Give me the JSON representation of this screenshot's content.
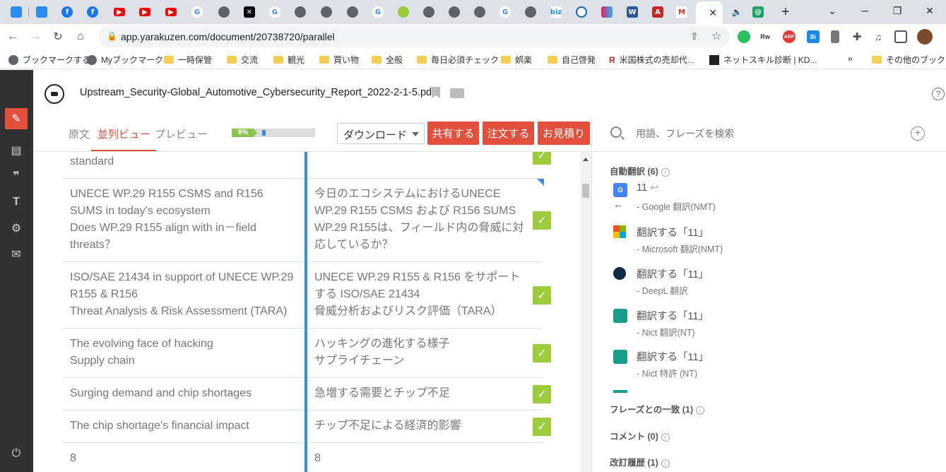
{
  "browser": {
    "url": "app.yarakuzen.com/document/20738720/parallel",
    "bookmarks": [
      "ブックマークする",
      "Myブックマーク",
      "一時保管",
      "交流",
      "観光",
      "買い物",
      "全般",
      "毎日必須チェック",
      "娯楽",
      "自己啓発",
      "米国株式の売却代...",
      "ネットスキル診断 | KD...",
      "その他のブックマーク"
    ],
    "ext_abp": "ABP"
  },
  "rail": {
    "icons": [
      "pen-icon",
      "document-icon",
      "quote-icon",
      "text-icon",
      "gear-icon",
      "mail-icon",
      "power-icon"
    ]
  },
  "doc": {
    "title": "Upstream_Security-Global_Automotive_Cybersecurity_Report_2022-2-1-5.pdf"
  },
  "views": {
    "original": "原文",
    "parallel": "並列ビュー",
    "preview": "プレビュー",
    "progress": 8,
    "progress_label": "8%",
    "download": "ダウンロード",
    "share": "共有する",
    "order": "注文する",
    "quote": "お見積り"
  },
  "rows": [
    {
      "src": "standard",
      "tgt": ""
    },
    {
      "src": "UNECE WP.29 R155 CSMS and R156 SUMS in today's ecosystem\nDoes WP.29 R155 align with in－field threats？",
      "tgt": "今日のエコシステムにおけるUNECE WP.29 R155 CSMS および R156 SUMS\nWP.29 R155は、フィールド内の脅威に対応しているか？"
    },
    {
      "src": "ISO/SAE 21434 in support of UNECE WP.29 R155 & R156\nThreat Analysis & Risk Assessment (TARA)",
      "tgt": "UNECE WP.29 R155 & R156 をサポートする ISO/SAE 21434\n脅威分析およびリスク評価（TARA）"
    },
    {
      "src": "The evolving face of hacking\nSupply chain",
      "tgt": "ハッキングの進化する様子\nサプライチェーン"
    },
    {
      "src": "Surging demand and chip shortages",
      "tgt": "急増する需要とチップ不足"
    },
    {
      "src": "The chip shortage's financial impact",
      "tgt": "チップ不足による経済的影響"
    },
    {
      "src": "8",
      "tgt": "8"
    }
  ],
  "panel": {
    "search_placeholder": "用語、フレーズを検索",
    "auto_title": "自動翻訳 (6)",
    "mt": [
      {
        "main": "11",
        "sub": "- Google 翻訳(NMT)",
        "icon": "google-translate-icon",
        "color": "#4285f4"
      },
      {
        "main": "翻訳する「11」",
        "sub": "- Microsoft 翻訳(NMT)",
        "icon": "microsoft-icon",
        "color": "#f25022"
      },
      {
        "main": "翻訳する「11」",
        "sub": "- DeepL 翻訳",
        "icon": "deepl-icon",
        "color": "#0f2b46"
      },
      {
        "main": "翻訳する「11」",
        "sub": "- Nict 翻訳(NT)",
        "icon": "nict-icon",
        "color": "#1a9b8c"
      },
      {
        "main": "翻訳する「11」",
        "sub": "- Nict 特許 (NT)",
        "icon": "nict-patent-icon",
        "color": "#1a9b8c"
      }
    ],
    "phrase_title": "フレーズとの一致 (1)",
    "comment_title": "コメント (0)",
    "history_title": "改訂履歴 (1)"
  }
}
